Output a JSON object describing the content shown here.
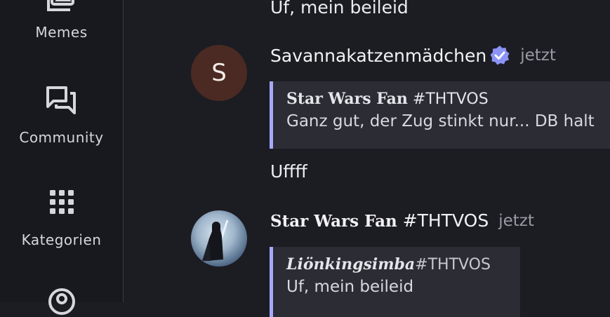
{
  "sidebar": {
    "items": [
      {
        "label": "Memes",
        "icon": "memes-icon"
      },
      {
        "label": "Community",
        "icon": "community-icon"
      },
      {
        "label": "Kategorien",
        "icon": "grid-icon"
      },
      {
        "label": "",
        "icon": "location-icon"
      }
    ]
  },
  "chat": {
    "messages": [
      {
        "text": "Uf, mein beileid"
      },
      {
        "author": "Savannakatzenmädchen",
        "avatar_letter": "S",
        "verified": true,
        "time": "jetzt",
        "quote_author_name": "Star Wars Fan",
        "quote_author_tag": "#THTVOS",
        "quote_text": "Ganz gut, der Zug stinkt nur... DB halt",
        "text": "Uffff"
      },
      {
        "author_name": "Star Wars Fan",
        "author_tag": "#THTVOS",
        "avatar_icon": "darth-vader-avatar",
        "time": "jetzt",
        "quote_author_name": "Liönkingsimba",
        "quote_author_tag": "#THTVOS",
        "quote_text": "Uf, mein beileid"
      }
    ]
  },
  "colors": {
    "accent": "#a6a8ff",
    "verified": "#8b93f5",
    "background": "#1c1c23",
    "sidebar": "#18181f"
  }
}
